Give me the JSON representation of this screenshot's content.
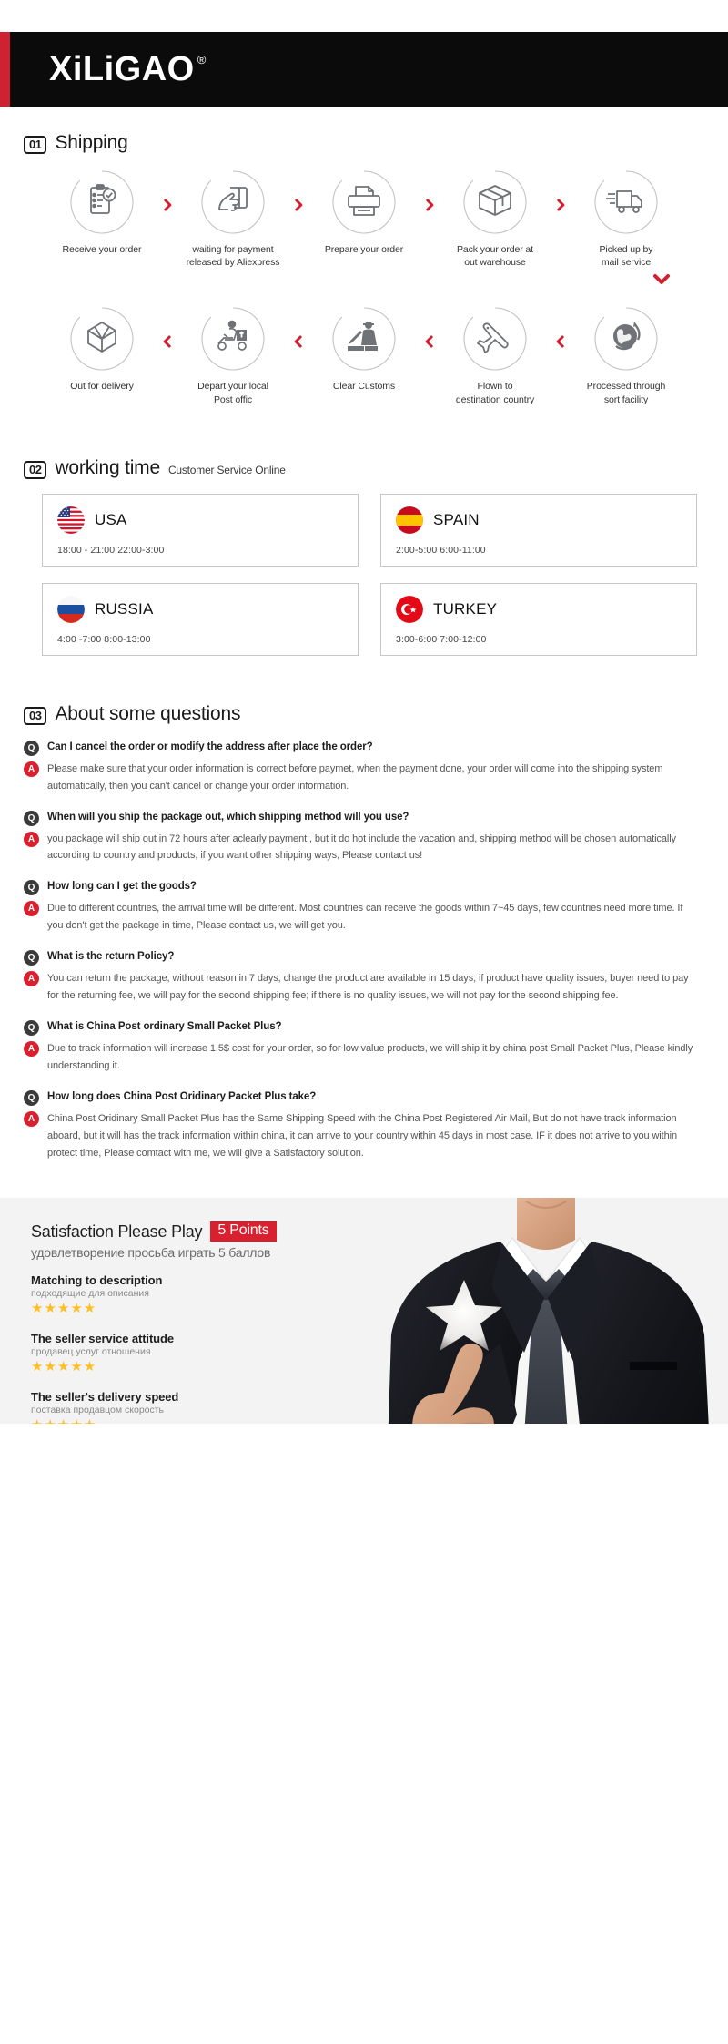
{
  "header": {
    "brand": "XiLiGAO",
    "registered_mark": "®",
    "accent_color": "#cf2130",
    "background_color": "#0b0b0b"
  },
  "shipping": {
    "number": "01",
    "title": "Shipping",
    "row1": [
      {
        "label": "Receive your order",
        "icon": "clipboard-check-icon"
      },
      {
        "label": "waiting for payment\nreleased by Aliexpress",
        "icon": "hand-card-icon"
      },
      {
        "label": "Prepare your order",
        "icon": "printer-icon"
      },
      {
        "label": "Pack your order at\nout warehouse",
        "icon": "box-icon"
      },
      {
        "label": "Picked up by\nmail service",
        "icon": "truck-icon"
      }
    ],
    "row2": [
      {
        "label": "Out  for delivery",
        "icon": "open-box-icon"
      },
      {
        "label": "Depart your local\nPost offic",
        "icon": "scooter-courier-icon"
      },
      {
        "label": "Clear Customs",
        "icon": "customs-officer-icon"
      },
      {
        "label": "Flown to\ndestination country",
        "icon": "airplane-icon"
      },
      {
        "label": "Processed through\nsort facility",
        "icon": "globe-icon"
      }
    ],
    "chevron_right_icon": "chevron-right-icon",
    "chevron_left_icon": "chevron-left-icon",
    "chevron_down_icon": "chevron-down-icon",
    "chevron_color": "#cf2130"
  },
  "working_time": {
    "number": "02",
    "title": "working time",
    "subtitle": "Customer Service Online",
    "countries": [
      {
        "name": "USA",
        "flag": "usa-flag-icon",
        "hours": "18:00 - 21:00   22:00-3:00"
      },
      {
        "name": "SPAIN",
        "flag": "spain-flag-icon",
        "hours": "2:00-5:00     6:00-11:00"
      },
      {
        "name": "RUSSIA",
        "flag": "russia-flag-icon",
        "hours": "4:00 -7:00   8:00-13:00"
      },
      {
        "name": "TURKEY",
        "flag": "turkey-flag-icon",
        "hours": "3:00-6:00    7:00-12:00"
      }
    ]
  },
  "faq": {
    "number": "03",
    "title": "About some questions",
    "q_badge": "Q",
    "a_badge": "A",
    "items": [
      {
        "question": "Can I cancel the order or modify the address after place the order?",
        "answer": "Please make sure that your order information is correct before paymet, when the payment done, your order will come into the shipping system automatically, then you can't cancel or change your order information."
      },
      {
        "question": "When will you ship the package out, which shipping method will you use?",
        "answer": "you package will ship out in 72 hours after aclearly payment , but it do hot include the vacation and, shipping method will be chosen automatically according to country and products, if you want other shipping ways, Please contact us!"
      },
      {
        "question": "How long can I get the goods?",
        "answer": "Due to different countries, the arrival time will be different. Most countries can receive the goods within 7~45 days, few countries need more time. If you don't get the package in time, Please contact us, we will get you."
      },
      {
        "question": "What is the return Policy?",
        "answer": "You can return the package, without reason in 7 days, change the product are available in 15 days; if product have quality issues, buyer need to pay for the returning fee, we will pay for the second shipping fee; if there is no quality issues, we will not pay for the second shipping fee."
      },
      {
        "question": "What is China Post ordinary Small Packet Plus?",
        "answer": "Due to track information will increase 1.5$ cost for your order, so for low value products, we will ship it by china post Small Packet Plus, Please kindly understanding it."
      },
      {
        "question": "How long does China Post Oridinary Packet Plus take?",
        "answer": "China Post Oridinary Small Packet Plus has the Same Shipping Speed with the China Post Registered Air Mail, But do not have track information aboard, but it will has the track information within china, it can arrive to your country within 45 days in most case. IF it does not arrive to you within protect time, Please comtact with me, we will give a Satisfactory solution."
      }
    ]
  },
  "satisfaction": {
    "title": "Satisfaction Please Play",
    "points_badge": "5 Points",
    "points_badge_color": "#d9202f",
    "subtitle": "удовлетворение просьба играть 5 баллов",
    "ratings": [
      {
        "title": "Matching to description",
        "subtitle": "подходящие для описания",
        "stars": "★★★★★",
        "value": 5
      },
      {
        "title": "The seller service attitude",
        "subtitle": "продавец услуг отношения",
        "stars": "★★★★★",
        "value": 5
      },
      {
        "title": "The seller's delivery speed",
        "subtitle": "поставка продавцом скорость",
        "stars": "★★★★★",
        "value": 5
      }
    ],
    "photo_alt": "businessman-pointing-star-photo",
    "star_color": "#fdbf27",
    "background_color": "#f3f3f3"
  }
}
